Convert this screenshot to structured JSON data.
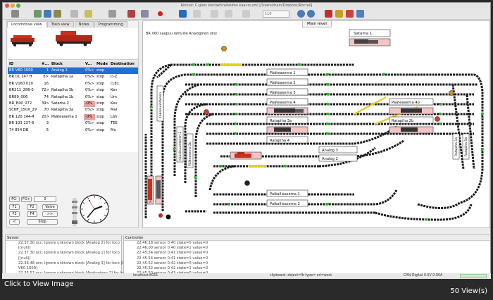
{
  "window": {
    "title": "Rocrail: C-gleis kentaktiraiteiden kaavio.xml [/Users/main/Dropbox/Rocrail]"
  },
  "toolbar": {
    "zoom": "110"
  },
  "left_tabs": [
    "Locomotive view",
    "Train view",
    "Notes",
    "Programming"
  ],
  "loco_table": {
    "headers": [
      "ID",
      "#...",
      "Block",
      "V...",
      "Mode",
      "Destination"
    ],
    "rows": [
      {
        "id": "BR V60 1009",
        "num": "1",
        "block": "Analog 1",
        "v": "0%>",
        "mode": "stop",
        "dest": "",
        "selected": true,
        "hl": false
      },
      {
        "id": "BR 01 147 H",
        "num": "6>",
        "block": "Ratapiha 1a",
        "v": "0%>",
        "mode": "stop",
        "dest": "D-Z",
        "selected": false,
        "hl": false
      },
      {
        "id": "BR V160 029",
        "num": "16",
        "block": "",
        "v": "0%>",
        "mode": "stop",
        "dest": "(181",
        "selected": false,
        "hl": false
      },
      {
        "id": "BR211_286-0",
        "num": "72>",
        "block": "Ratapiha 3b",
        "v": "0%>",
        "mode": "stop",
        "dest": "Kev",
        "selected": false,
        "hl": false
      },
      {
        "id": "BR89_006",
        "num": "74",
        "block": "Ratapiha 1b",
        "v": "0%>",
        "mode": "stop",
        "dest": "Um",
        "selected": false,
        "hl": false
      },
      {
        "id": "BR_E40_072",
        "num": "39>",
        "block": "Satama 2",
        "v": "-0%",
        "mode": "stop",
        "dest": "Kev",
        "selected": false,
        "hl": true
      },
      {
        "id": "SCNF_150X_29",
        "num": "70",
        "block": "Ratapiha 3a",
        "v": "0%>",
        "mode": "stop",
        "dest": "Mal",
        "selected": false,
        "hl": false
      },
      {
        "id": "BR 120 144-4",
        "num": "20>",
        "block": "Pääteasema 1",
        "v": "-0%",
        "mode": "stop",
        "dest": "Läh",
        "selected": false,
        "hl": true
      },
      {
        "id": "BR 103 137-6",
        "num": "3",
        "block": "",
        "v": "0%>",
        "mode": "stop",
        "dest": "TEE",
        "selected": false,
        "hl": false
      },
      {
        "id": "74 854 DB",
        "num": "5",
        "block": "",
        "v": "0%>",
        "mode": "stop",
        "dest": "Mu",
        "selected": false,
        "hl": false
      }
    ]
  },
  "controls": {
    "fg_minus": "FG-",
    "fg_plus": "FG+",
    "speed": "0",
    "f1": "F1",
    "f2": "F2",
    "valve": "Valve",
    "f3": "F3",
    "f4": "F4",
    "next": ">>",
    "left": "<",
    "stop": "Stop"
  },
  "main_tab": "Main level",
  "main_status": "BR V60 saapuu lahtuille Analoginen yksi",
  "blocks": [
    {
      "id": "b-satama1",
      "label": "Satama 1"
    },
    {
      "id": "b-paa1",
      "label": "Pääteasema 1"
    },
    {
      "id": "b-paa2",
      "label": "Pääteasema 2"
    },
    {
      "id": "b-paa3",
      "label": "Pääteasema 3"
    },
    {
      "id": "b-paa4",
      "label": "Pääteasema 4"
    },
    {
      "id": "b-paa4b",
      "label": "Pääteasema 4b"
    },
    {
      "id": "b-rata3a",
      "label": "Ratapiha 3a"
    },
    {
      "id": "b-rata2b",
      "label": "Ratapiha 2b"
    },
    {
      "id": "b-rata4",
      "label": "Ratapiha 4"
    },
    {
      "id": "b-analog3",
      "label": "Analog 3"
    },
    {
      "id": "b-analog2",
      "label": "Analog 2"
    },
    {
      "id": "b-paik1",
      "label": "Paikallisasema 1"
    },
    {
      "id": "b-paik2",
      "label": "Paikallisasema 2"
    }
  ],
  "vblocks": [
    {
      "label": "Kaksisuuntainen"
    },
    {
      "label": "Kaksisuuntainen 2"
    },
    {
      "label": "Pääteasema 2b"
    },
    {
      "label": "Ratapiha 1a"
    },
    {
      "label": "Ratapiha 1b"
    },
    {
      "label": "Satama 2"
    }
  ],
  "server": {
    "title": "Server",
    "lines": [
      "22.37.30 occ: Ignore unknown block [Analog 2] for loco",
      "[(null)]",
      "22.37.30 occ: Ignore unknown block [Analog 1] for loco",
      "[(null)]",
      "22.36.48 occ: Ignore unknown block [Analog 3] for loco [BR",
      "V60 1009]",
      "22.35.52 occ: Ignore unknown block [Analoginen 2] for loco",
      "[(null)]"
    ]
  },
  "controller": {
    "title": "Controller",
    "lines": [
      "22.46.18 sensor 0:40 state=0 value=0",
      "22.46.00 sensor 0:40 state=1 value=0",
      "22.45.54 sensor 0:41 state=0 value=0",
      "22.45.54 sensor 0:41 state=1 value=0",
      "22.45.52 sensor 0:42 state=0 value=0",
      "22.45.52 sensor 0:42 state=1 value=0",
      "22.45.50 sensor 0:43 state=0 value=0",
      "22.45.50 sensor 0:43 state=1 value=0"
    ]
  },
  "statusbar": {
    "host": "localhost:8051",
    "clipboard": "clipboard: object=fb type= ori=west",
    "can": "CAN Digital 0.0V 0.00A"
  },
  "footer": {
    "click": "Click to View Image",
    "views": "50 View(s)"
  }
}
